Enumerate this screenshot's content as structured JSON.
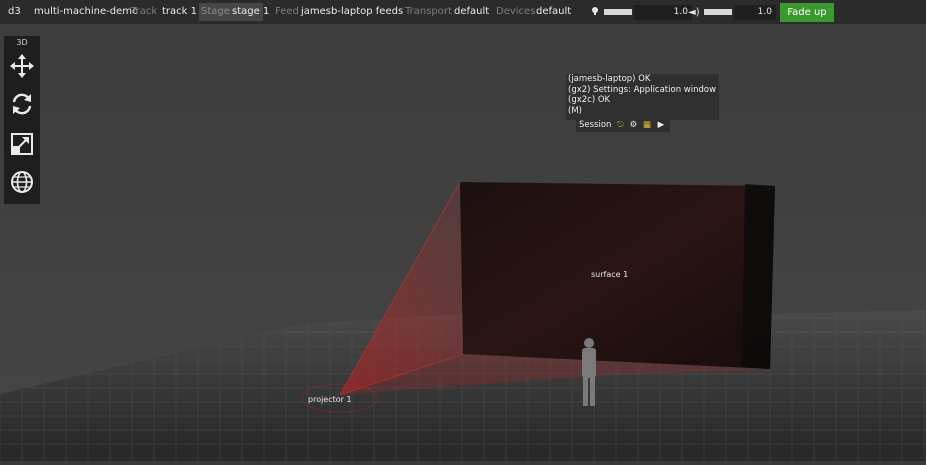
{
  "topbar": {
    "app": "d3",
    "project": "multi-machine-demo",
    "track_label": "Track",
    "track_value": "track 1",
    "stage_label": "Stage",
    "stage_value": "stage 1",
    "feed_label": "Feed",
    "feed_value": "jamesb-laptop feeds",
    "transport_label": "Transport",
    "transport_value": "default",
    "devices_label": "Devices",
    "devices_value": "default",
    "brightness_value": "1.0",
    "volume_value": "1.0",
    "fade_label": "Fade up",
    "fade_color": "#3b9a2f",
    "icons": [
      "lightbulb-icon",
      "speaker-icon"
    ]
  },
  "toolbar": {
    "mode": "3D",
    "tools": [
      "move-icon",
      "rotate-icon",
      "scale-icon",
      "globe-icon"
    ]
  },
  "notifications": {
    "lines": [
      "(jamesb-laptop) OK",
      "(gx2) Settings: Application window",
      "(gx2c) OK",
      " (M)"
    ],
    "session_label": "Session",
    "session_icons": [
      "network-icon",
      "gear-icon",
      "machine-icon",
      "play-icon"
    ]
  },
  "scene": {
    "surface_label": "surface 1",
    "projector_label": "projector 1",
    "projector_color": "#c82020"
  }
}
